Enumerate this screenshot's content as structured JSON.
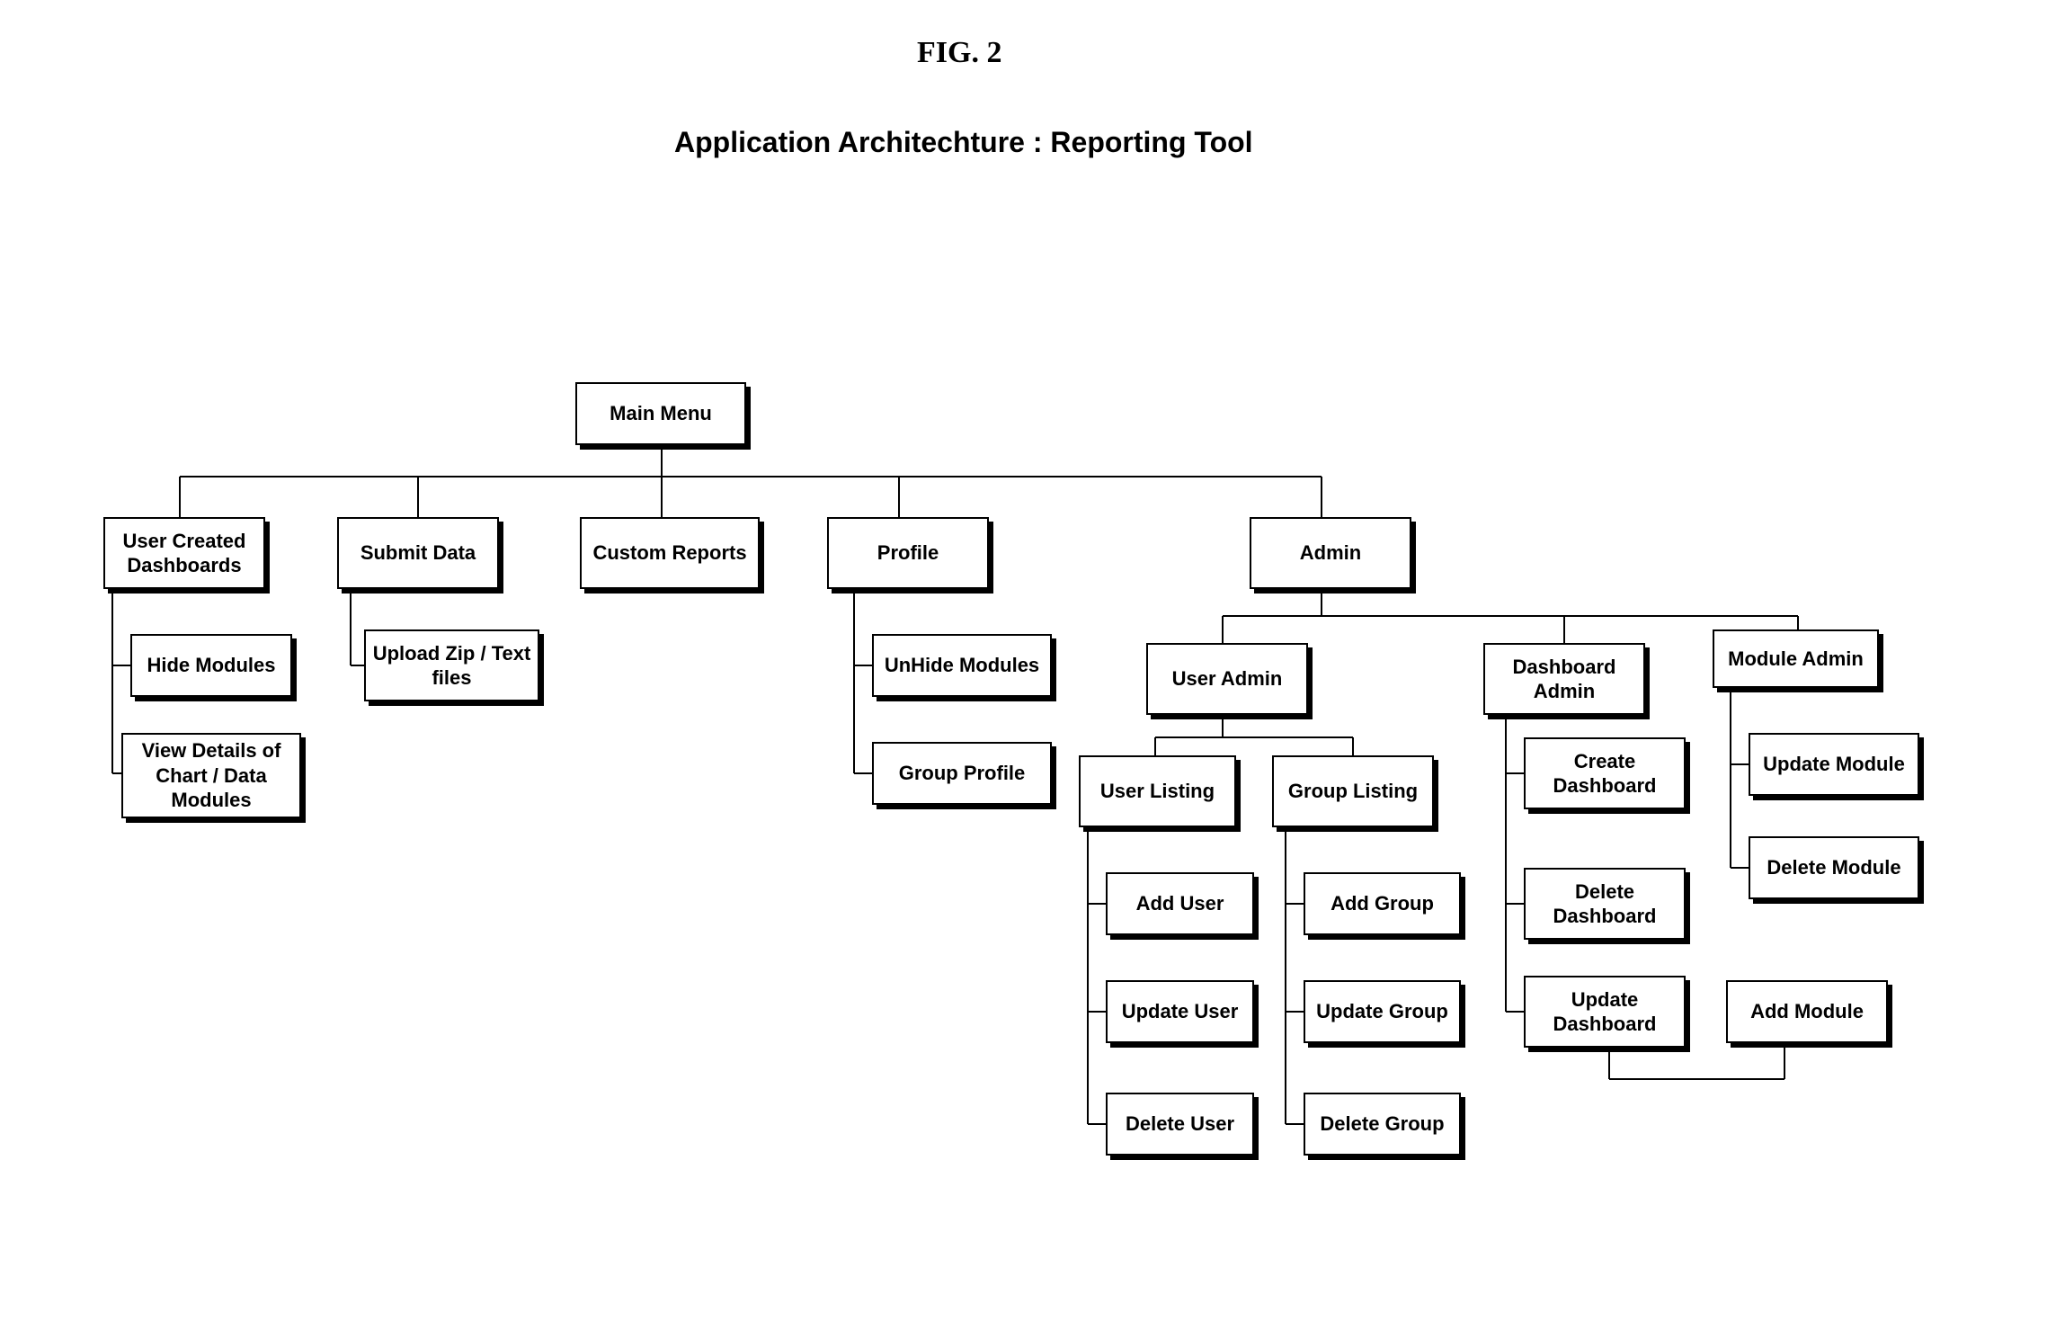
{
  "figure_label": "FIG. 2",
  "title": "Application Architechture : Reporting Tool",
  "nodes": {
    "main_menu": "Main Menu",
    "user_created_dashboards": "User Created Dashboards",
    "submit_data": "Submit Data",
    "custom_reports": "Custom Reports",
    "profile": "Profile",
    "admin": "Admin",
    "hide_modules": "Hide Modules",
    "view_details": "View Details of Chart / Data Modules",
    "upload_zip": "Upload Zip / Text files",
    "unhide_modules": "UnHide Modules",
    "group_profile": "Group Profile",
    "user_admin": "User Admin",
    "dashboard_admin": "Dashboard Admin",
    "module_admin": "Module Admin",
    "user_listing": "User Listing",
    "group_listing": "Group Listing",
    "add_user": "Add User",
    "update_user": "Update User",
    "delete_user": "Delete User",
    "add_group": "Add Group",
    "update_group": "Update Group",
    "delete_group": "Delete Group",
    "create_dashboard": "Create Dashboard",
    "delete_dashboard": "Delete Dashboard",
    "update_dashboard": "Update Dashboard",
    "add_module": "Add Module",
    "update_module": "Update Module",
    "delete_module": "Delete Module"
  }
}
